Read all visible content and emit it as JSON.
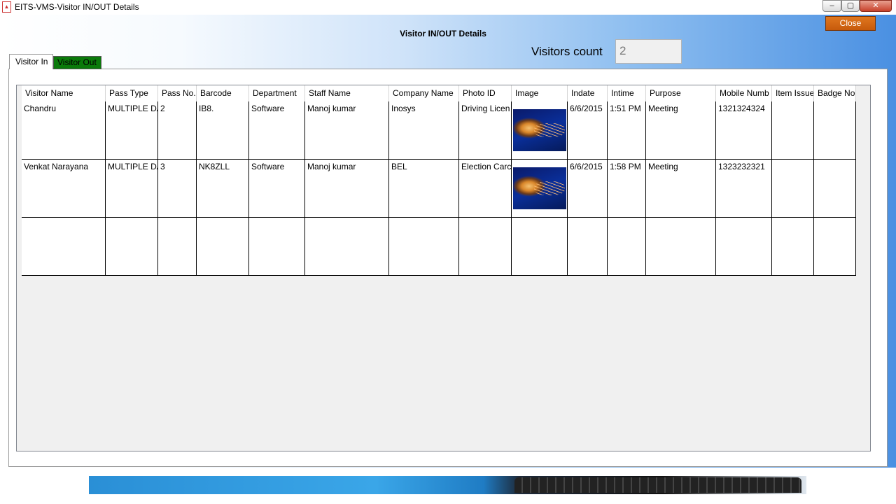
{
  "window": {
    "title": "EITS-VMS-Visitor IN/OUT Details",
    "icon": "app-logo-icon",
    "controls": {
      "minimize": "–",
      "maximize": "▢",
      "close": "✕"
    }
  },
  "actions": {
    "close_label": "Close"
  },
  "page": {
    "title": "Visitor IN/OUT Details"
  },
  "counter": {
    "label": "Visitors count",
    "value": "2"
  },
  "tabs": [
    {
      "label": "Visitor In",
      "selected": true
    },
    {
      "label": "Visitor Out",
      "selected": false
    }
  ],
  "grid": {
    "columns": [
      "Visitor Name",
      "Pass Type",
      "Pass No.",
      "Barcode",
      "Department",
      "Staff Name",
      "Company Name",
      "Photo ID",
      "Image",
      "Indate",
      "Intime",
      "Purpose",
      "Mobile Numb",
      "Item Issue",
      "Badge No"
    ],
    "rows": [
      {
        "visitor_name": "Chandru",
        "pass_type": "MULTIPLE DA",
        "pass_no": "2",
        "barcode": "IB8.",
        "department": "Software",
        "staff_name": "Manoj kumar",
        "company_name": "Inosys",
        "photo_id": "Driving Licen",
        "image": "jellyfish-photo",
        "indate": "6/6/2015",
        "intime": "1:51 PM",
        "purpose": "Meeting",
        "mobile": "1321324324",
        "item_issue": "",
        "badge_no": ""
      },
      {
        "visitor_name": "Venkat Narayana",
        "pass_type": "MULTIPLE DA",
        "pass_no": "3",
        "barcode": "NK8ZLL",
        "department": "Software",
        "staff_name": "Manoj kumar",
        "company_name": "BEL",
        "photo_id": "Election Carc",
        "image": "jellyfish-photo",
        "indate": "6/6/2015",
        "intime": "1:58 PM",
        "purpose": "Meeting",
        "mobile": "1323232321",
        "item_issue": "",
        "badge_no": ""
      },
      {
        "visitor_name": "",
        "pass_type": "",
        "pass_no": "",
        "barcode": "",
        "department": "",
        "staff_name": "",
        "company_name": "",
        "photo_id": "",
        "image": "",
        "indate": "",
        "intime": "",
        "purpose": "",
        "mobile": "",
        "item_issue": "",
        "badge_no": ""
      }
    ]
  },
  "colors": {
    "close_button": "#d2690f",
    "visitor_out_tab": "#0a7a0a",
    "window_gradient_end": "#4a90e2"
  }
}
